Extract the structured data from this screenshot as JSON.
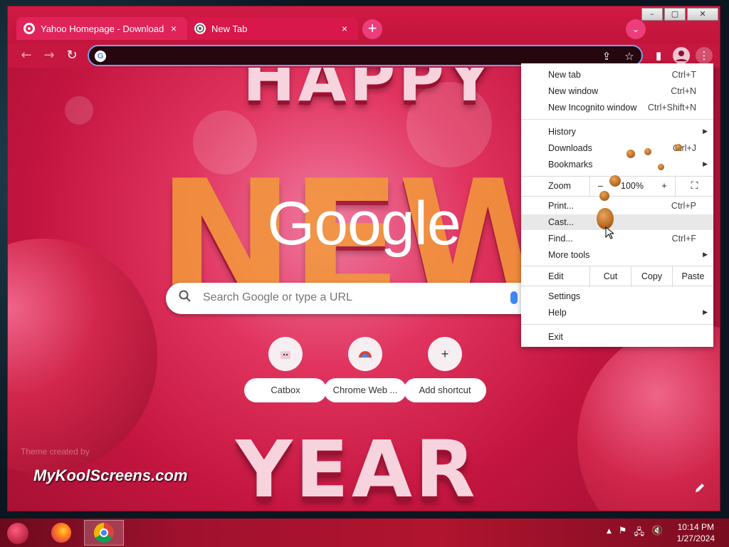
{
  "tabs": [
    {
      "title": "Yahoo Homepage - Download",
      "close": "×"
    },
    {
      "title": "New Tab",
      "close": "×"
    }
  ],
  "window_controls": {
    "minimize": "–",
    "maximize": "▢",
    "close": "✕"
  },
  "new_tab_symbol": "+",
  "tab_search_symbol": "⌄",
  "toolbar": {
    "back": "←",
    "forward": "→",
    "reload": "↻",
    "omnibox_value": "",
    "share": "⇪",
    "star": "☆",
    "sidepanel": "▮",
    "menu": "⋮",
    "g_letter": "G"
  },
  "ntp": {
    "logo": "Google",
    "search_placeholder": "Search Google or type a URL",
    "shortcuts": [
      {
        "label": "Catbox",
        "icon": "catbox-icon"
      },
      {
        "label": "Chrome Web ...",
        "icon": "chrome-web-store-icon"
      },
      {
        "label": "Add shortcut",
        "icon": "plus-icon",
        "symbol": "+"
      }
    ],
    "theme_credit": "Theme created by",
    "brand": "MyKoolScreens.com",
    "background_words": {
      "top": "HAPPY",
      "middle": "NEW",
      "bottom": "YEAR"
    }
  },
  "menu": {
    "items": [
      {
        "label": "New tab",
        "shortcut": "Ctrl+T"
      },
      {
        "label": "New window",
        "shortcut": "Ctrl+N"
      },
      {
        "label": "New Incognito window",
        "shortcut": "Ctrl+Shift+N"
      },
      {
        "label": "History",
        "shortcut": ""
      },
      {
        "label": "Downloads",
        "shortcut": "Ctrl+J"
      },
      {
        "label": "Bookmarks",
        "shortcut": ""
      },
      {
        "label": "Print...",
        "shortcut": "Ctrl+P"
      },
      {
        "label": "Cast...",
        "shortcut": ""
      },
      {
        "label": "Find...",
        "shortcut": "Ctrl+F"
      },
      {
        "label": "More tools",
        "shortcut": ""
      },
      {
        "label": "Settings",
        "shortcut": ""
      },
      {
        "label": "Help",
        "shortcut": ""
      },
      {
        "label": "Exit",
        "shortcut": ""
      }
    ],
    "zoom": {
      "label": "Zoom",
      "minus": "–",
      "value": "100%",
      "plus": "+",
      "fullscreen": "⛶"
    },
    "edit": {
      "label": "Edit",
      "cut": "Cut",
      "copy": "Copy",
      "paste": "Paste"
    },
    "submenu_arrow": "▶"
  },
  "taskbar": {
    "tray_icons": [
      "▲",
      "⚑",
      "🖧",
      "🔇"
    ],
    "time": "10:14 PM",
    "date": "1/27/2024"
  },
  "colors": {
    "browser_frame": "#c4163c",
    "menu_bg": "#ffffff",
    "omnibox_border": "#7aa0e8"
  }
}
